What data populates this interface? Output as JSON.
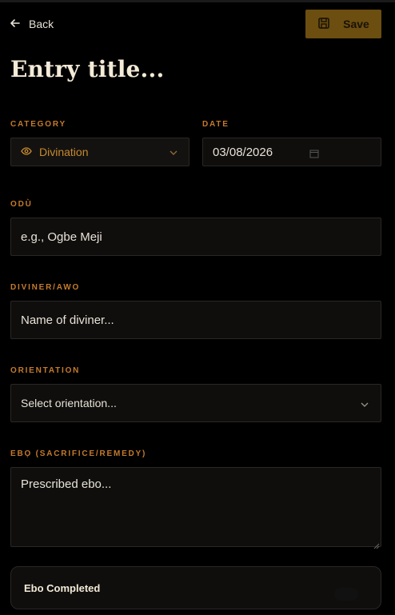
{
  "header": {
    "back_label": "Back",
    "save_label": "Save"
  },
  "entry": {
    "title_placeholder": "Entry title..."
  },
  "form": {
    "category": {
      "label": "CATEGORY",
      "value": "Divination"
    },
    "date": {
      "label": "DATE",
      "value": "03/08/2026"
    },
    "odu": {
      "label": "ODÙ",
      "placeholder": "e.g., Ogbe Meji"
    },
    "diviner": {
      "label": "DIVINER/AWO",
      "placeholder": "Name of diviner..."
    },
    "orientation": {
      "label": "ORIENTATION",
      "value": "Select orientation..."
    },
    "ebo": {
      "label": "EBỌ (SACRIFICE/REMEDY)",
      "placeholder": "Prescribed ebo..."
    },
    "ebo_completed": {
      "label": "Ebo Completed"
    }
  },
  "icons": {
    "back": "arrow-left-icon",
    "save": "floppy-disk-icon",
    "category": "eye-icon",
    "dropdown": "chevron-down-icon",
    "date": "calendar-icon"
  },
  "colors": {
    "background": "#000000",
    "accent_label": "#c47a2c",
    "save_button": "#6b4e10",
    "field_bg": "#0f0e0d"
  }
}
